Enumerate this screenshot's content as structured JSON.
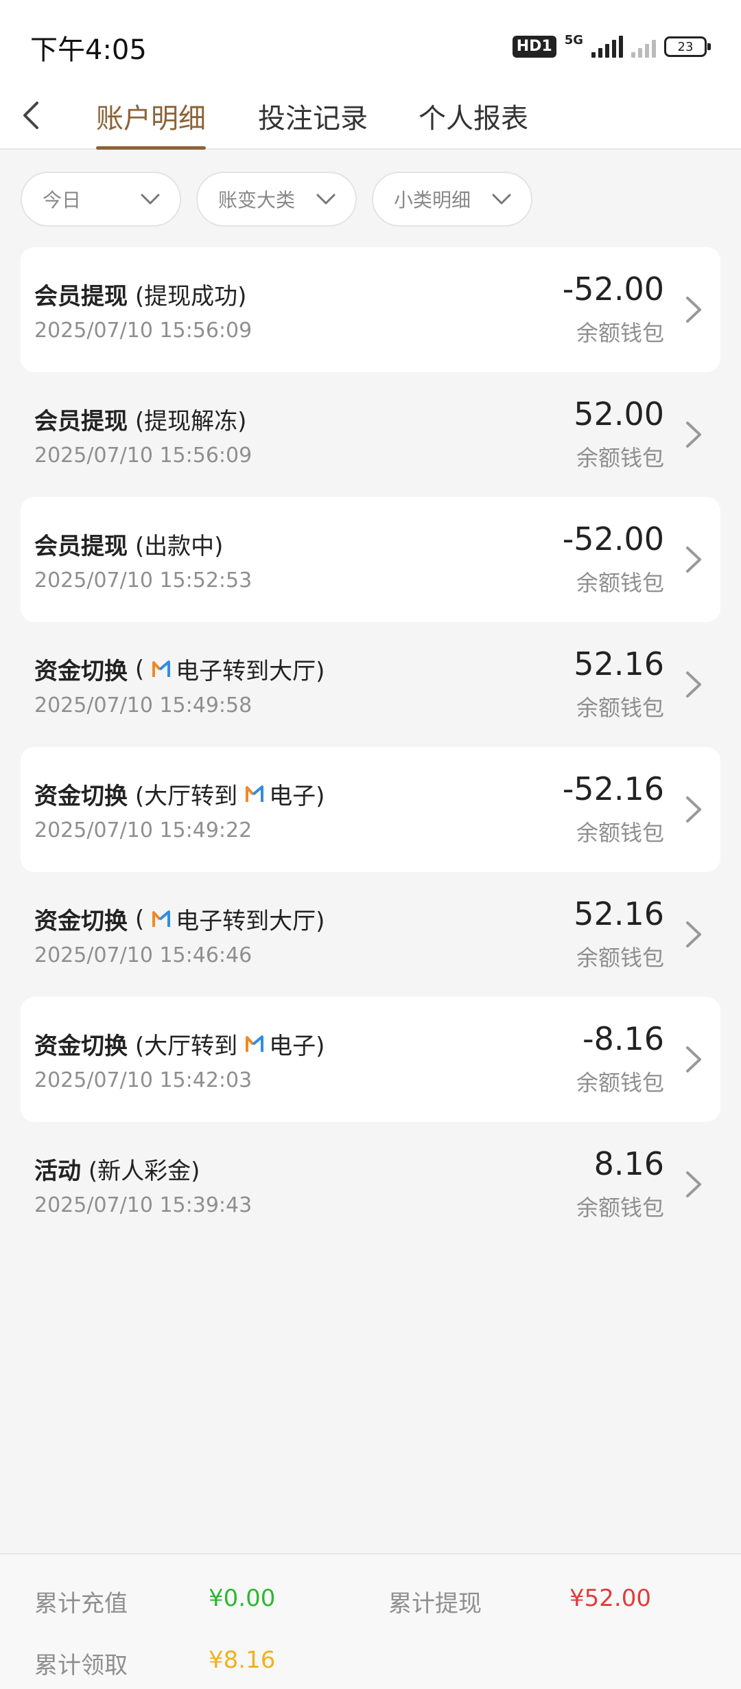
{
  "status_bar": {
    "time": "下午4:05",
    "hd_badge": "HD1",
    "network": "5G",
    "battery": "23"
  },
  "header": {
    "back_icon": "chevron-left-icon",
    "tabs": [
      {
        "label": "账户明细",
        "active": true
      },
      {
        "label": "投注记录",
        "active": false
      },
      {
        "label": "个人报表",
        "active": false
      }
    ],
    "active_color": "#8b6338"
  },
  "filters": [
    {
      "label": "今日",
      "icon": "chevron-down-icon"
    },
    {
      "label": "账变大类",
      "icon": "chevron-down-icon"
    },
    {
      "label": "小类明细",
      "icon": "chevron-down-icon"
    }
  ],
  "records": [
    {
      "type": "会员提现",
      "sub_before": "(提现成功)",
      "sub_after": "",
      "time": "2025/07/10 15:56:09",
      "amount": "-52.00",
      "wallet": "余额钱包"
    },
    {
      "type": "会员提现",
      "sub_before": "(提现解冻)",
      "sub_after": "",
      "time": "2025/07/10 15:56:09",
      "amount": "52.00",
      "wallet": "余额钱包"
    },
    {
      "type": "会员提现",
      "sub_before": "(出款中)",
      "sub_after": "",
      "time": "2025/07/10 15:52:53",
      "amount": "-52.00",
      "wallet": "余额钱包"
    },
    {
      "type": "资金切换",
      "sub_before": "(",
      "sub_after": "电子转到大厅)",
      "time": "2025/07/10 15:49:58",
      "amount": "52.16",
      "wallet": "余额钱包"
    },
    {
      "type": "资金切换",
      "sub_before": "(大厅转到",
      "sub_after": "电子)",
      "time": "2025/07/10 15:49:22",
      "amount": "-52.16",
      "wallet": "余额钱包"
    },
    {
      "type": "资金切换",
      "sub_before": "(",
      "sub_after": "电子转到大厅)",
      "time": "2025/07/10 15:46:46",
      "amount": "52.16",
      "wallet": "余额钱包"
    },
    {
      "type": "资金切换",
      "sub_before": "(大厅转到",
      "sub_after": "电子)",
      "time": "2025/07/10 15:42:03",
      "amount": "-8.16",
      "wallet": "余额钱包"
    },
    {
      "type": "活动",
      "sub_before": "(新人彩金)",
      "sub_after": "",
      "time": "2025/07/10 15:39:43",
      "amount": "8.16",
      "wallet": "余额钱包"
    }
  ],
  "summary": {
    "total_deposit_label": "累计充值",
    "total_deposit_value": "¥0.00",
    "total_withdraw_label": "累计提现",
    "total_withdraw_value": "¥52.00",
    "total_claim_label": "累计领取",
    "total_claim_value": "¥8.16",
    "colors": {
      "deposit": "#2bb832",
      "withdraw": "#e23b3b",
      "claim": "#f0b21b"
    }
  }
}
